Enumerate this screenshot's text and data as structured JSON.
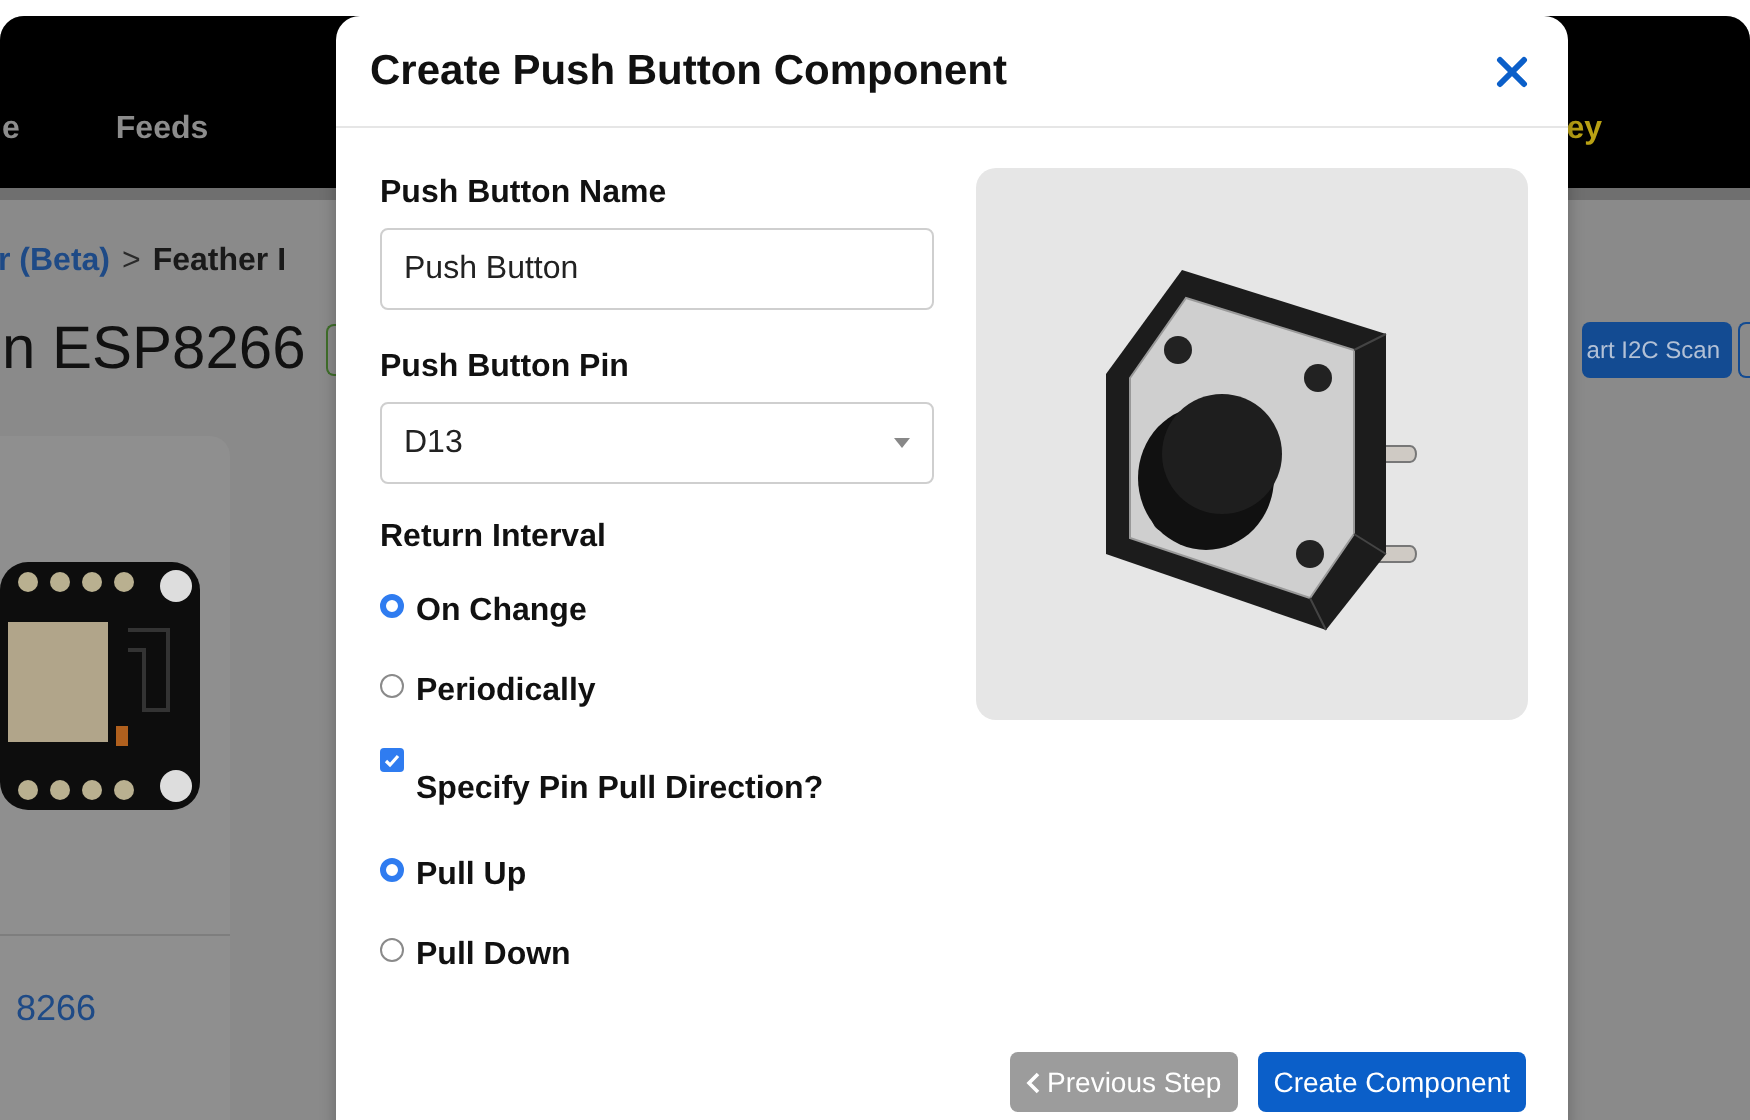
{
  "background": {
    "nav": [
      {
        "label": "e",
        "selected": false
      },
      {
        "label": "Feeds",
        "selected": false
      },
      {
        "label": "ey",
        "selected": true
      }
    ],
    "breadcrumb": {
      "link": "r (Beta)",
      "separator": ">",
      "current": "Feather I"
    },
    "title": "n ESP8266",
    "card_link": "8266",
    "scan_button": "art I2C Scan"
  },
  "modal": {
    "title": "Create Push Button Component",
    "fields": [
      {
        "kind": "text",
        "label": "Push Button Name",
        "value": "Push Button"
      },
      {
        "kind": "select",
        "label": "Push Button Pin",
        "value": "D13"
      }
    ],
    "return_interval": {
      "label": "Return Interval",
      "options": [
        {
          "label": "On Change",
          "selected": true
        },
        {
          "label": "Periodically",
          "selected": false
        }
      ]
    },
    "pull_direction": {
      "label": "Specify Pin Pull Direction?",
      "checked": true
    },
    "pull_options": [
      {
        "label": "Pull Up",
        "selected": true
      },
      {
        "label": "Pull Down",
        "selected": false
      }
    ],
    "buttons": [
      {
        "kind": "secondary",
        "label": "Previous Step"
      },
      {
        "kind": "primary",
        "label": "Create Component"
      }
    ]
  }
}
